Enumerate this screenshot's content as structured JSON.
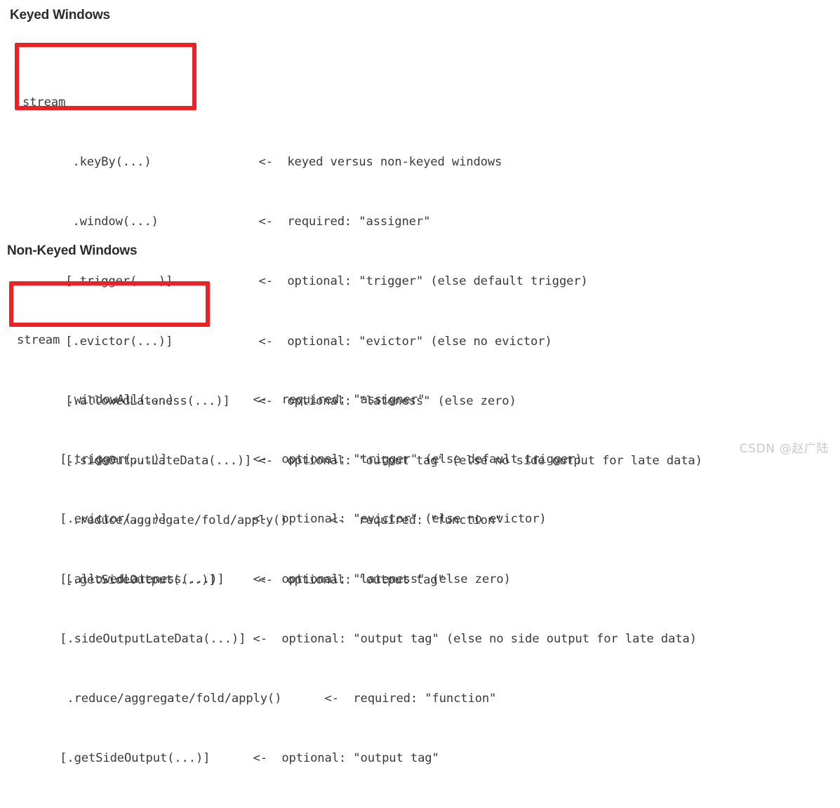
{
  "document": {
    "background_color": "#ffffff",
    "text_color": "#3a3a3a",
    "highlight_color": "#ed2024"
  },
  "sections": [
    {
      "id": "keyed",
      "heading": "Keyed Windows",
      "code_lines": [
        "stream",
        "       .keyBy(...)               <-  keyed versus non-keyed windows",
        "       .window(...)              <-  required: \"assigner\"",
        "      [.trigger(...)]            <-  optional: \"trigger\" (else default trigger)",
        "      [.evictor(...)]            <-  optional: \"evictor\" (else no evictor)",
        "      [.allowedLateness(...)]    <-  optional: \"lateness\" (else zero)",
        "      [.sideOutputLateData(...)] <-  optional: \"output tag\" (else no side output for late data)",
        "       .reduce/aggregate/fold/apply()      <-  required: \"function\"",
        "      [.getSideOutput(...)]      <-  optional: \"output tag\""
      ],
      "highlight": {
        "label": "keyed-window-assigner-highlight",
        "covers": [
          "stream",
          ".keyBy(...)",
          ".window(...)"
        ]
      }
    },
    {
      "id": "non-keyed",
      "heading": "Non-Keyed Windows",
      "code_lines": [
        "stream",
        "       .windowAll(...)           <-  required: \"assigner\"",
        "      [.trigger(...)]            <-  optional: \"trigger\" (else default trigger)",
        "      [.evictor(...)]            <-  optional: \"evictor\" (else no evictor)",
        "      [.allowedLateness(...)]    <-  optional: \"lateness\" (else zero)",
        "      [.sideOutputLateData(...)] <-  optional: \"output tag\" (else no side output for late data)",
        "       .reduce/aggregate/fold/apply()      <-  required: \"function\"",
        "      [.getSideOutput(...)]      <-  optional: \"output tag\""
      ],
      "highlight": {
        "label": "non-keyed-window-assigner-highlight",
        "covers": [
          "stream",
          ".windowAll(...)"
        ]
      }
    }
  ],
  "watermark": {
    "text": "CSDN @赵广陆"
  }
}
